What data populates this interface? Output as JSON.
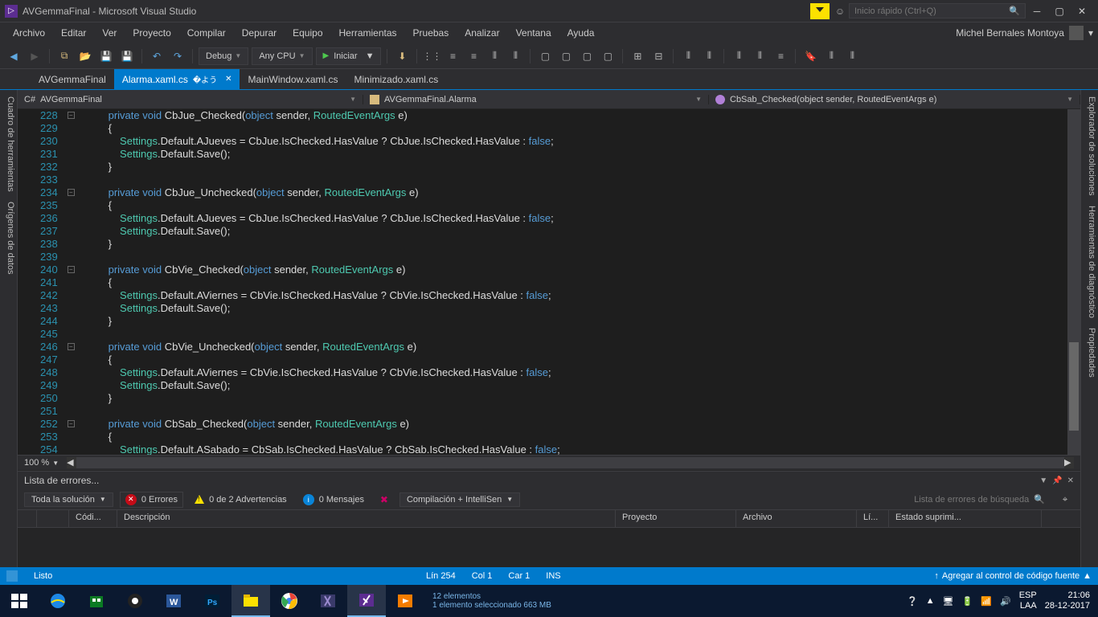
{
  "title": "AVGemmaFinal - Microsoft Visual Studio",
  "quicklaunch": "Inicio rápido (Ctrl+Q)",
  "menu": [
    "Archivo",
    "Editar",
    "Ver",
    "Proyecto",
    "Compilar",
    "Depurar",
    "Equipo",
    "Herramientas",
    "Pruebas",
    "Analizar",
    "Ventana",
    "Ayuda"
  ],
  "user": "Michel Bernales Montoya",
  "toolbar": {
    "config": "Debug",
    "platform": "Any CPU",
    "start": "Iniciar"
  },
  "project_tab": "AVGemmaFinal",
  "tabs": [
    {
      "label": "Alarma.xaml.cs",
      "active": true
    },
    {
      "label": "MainWindow.xaml.cs",
      "active": false
    },
    {
      "label": "Minimizado.xaml.cs",
      "active": false
    }
  ],
  "leftpanels": [
    "Cuadro de herramientas",
    "Orígenes de datos"
  ],
  "rightpanels": [
    "Explorador de soluciones",
    "Herramientas de diagnóstico",
    "Propiedades"
  ],
  "nav": {
    "scope": "AVGemmaFinal",
    "class": "AVGemmaFinal.Alarma",
    "member": "CbSab_Checked(object sender, RoutedEventArgs e)"
  },
  "zoom": "100 %",
  "lines": [
    {
      "n": 228,
      "txt": "        private void CbJue_Checked(object sender, RoutedEventArgs e)",
      "fold": true
    },
    {
      "n": 229,
      "txt": "        {"
    },
    {
      "n": 230,
      "txt": "            Settings.Default.AJueves = CbJue.IsChecked.HasValue ? CbJue.IsChecked.HasValue : false;"
    },
    {
      "n": 231,
      "txt": "            Settings.Default.Save();"
    },
    {
      "n": 232,
      "txt": "        }"
    },
    {
      "n": 233,
      "txt": ""
    },
    {
      "n": 234,
      "txt": "        private void CbJue_Unchecked(object sender, RoutedEventArgs e)",
      "fold": true
    },
    {
      "n": 235,
      "txt": "        {"
    },
    {
      "n": 236,
      "txt": "            Settings.Default.AJueves = CbJue.IsChecked.HasValue ? CbJue.IsChecked.HasValue : false;"
    },
    {
      "n": 237,
      "txt": "            Settings.Default.Save();"
    },
    {
      "n": 238,
      "txt": "        }"
    },
    {
      "n": 239,
      "txt": ""
    },
    {
      "n": 240,
      "txt": "        private void CbVie_Checked(object sender, RoutedEventArgs e)",
      "fold": true
    },
    {
      "n": 241,
      "txt": "        {"
    },
    {
      "n": 242,
      "txt": "            Settings.Default.AViernes = CbVie.IsChecked.HasValue ? CbVie.IsChecked.HasValue : false;"
    },
    {
      "n": 243,
      "txt": "            Settings.Default.Save();"
    },
    {
      "n": 244,
      "txt": "        }"
    },
    {
      "n": 245,
      "txt": ""
    },
    {
      "n": 246,
      "txt": "        private void CbVie_Unchecked(object sender, RoutedEventArgs e)",
      "fold": true
    },
    {
      "n": 247,
      "txt": "        {"
    },
    {
      "n": 248,
      "txt": "            Settings.Default.AViernes = CbVie.IsChecked.HasValue ? CbVie.IsChecked.HasValue : false;"
    },
    {
      "n": 249,
      "txt": "            Settings.Default.Save();"
    },
    {
      "n": 250,
      "txt": "        }"
    },
    {
      "n": 251,
      "txt": ""
    },
    {
      "n": 252,
      "txt": "        private void CbSab_Checked(object sender, RoutedEventArgs e)",
      "fold": true
    },
    {
      "n": 253,
      "txt": "        {"
    },
    {
      "n": 254,
      "txt": "            Settings.Default.ASabado = CbSab.IsChecked.HasValue ? CbSab.IsChecked.HasValue : false;"
    }
  ],
  "errorlist": {
    "title": "Lista de errores...",
    "scope": "Toda la solución",
    "errors": "0 Errores",
    "warnings": "0 de 2 Advertencias",
    "messages": "0 Mensajes",
    "build": "Compilación + IntelliSen",
    "search": "Lista de errores de búsqueda",
    "cols": [
      "",
      "",
      "Códi...",
      "Descripción",
      "Proyecto",
      "Archivo",
      "Lí...",
      "Estado suprimi..."
    ]
  },
  "status": {
    "ready": "Listo",
    "ln": "Lín 254",
    "col": "Col 1",
    "car": "Car 1",
    "ins": "INS",
    "source": "Agregar al control de código fuente"
  },
  "notif": {
    "items": "12 elementos",
    "sel": "1 elemento seleccionado  663 MB"
  },
  "tray": {
    "lang": "ESP",
    "kb": "LAA",
    "time": "21:06",
    "date": "28-12-2017"
  }
}
